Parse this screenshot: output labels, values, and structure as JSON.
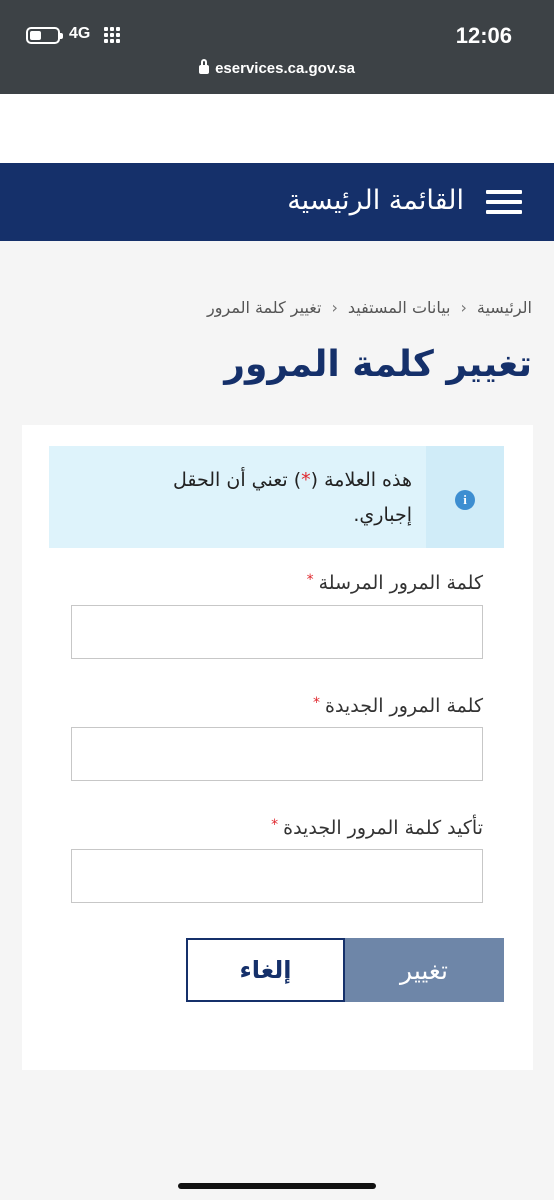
{
  "status_bar": {
    "network": "4G",
    "time": "12:06",
    "url": "eservices.ca.gov.sa"
  },
  "nav": {
    "menu_label": "القائمة الرئيسية",
    "menu_icon": "hamburger-icon"
  },
  "breadcrumb": {
    "items": [
      "الرئيسية",
      "بيانات المستفيد",
      "تغيير كلمة المرور"
    ],
    "separator": "<"
  },
  "page": {
    "title": "تغيير كلمة المرور"
  },
  "alert": {
    "icon": "info-icon",
    "icon_glyph": "i",
    "text_before": "هذه العلامة (",
    "star": "*",
    "text_after": ") تعني أن الحقل إجباري."
  },
  "form": {
    "required_marker": "*",
    "fields": [
      {
        "label": "كلمة المرور المرسلة",
        "value": "",
        "placeholder": ""
      },
      {
        "label": "كلمة المرور الجديدة",
        "value": "",
        "placeholder": ""
      },
      {
        "label": "تأكيد كلمة المرور الجديدة",
        "value": "",
        "placeholder": ""
      }
    ],
    "submit_label": "تغيير",
    "cancel_label": "إلغاء"
  },
  "colors": {
    "primary": "#15306a",
    "submit_button": "#6e86a8",
    "required": "#e0282e",
    "alert_bg": "#def3fb",
    "info_icon": "#3d8ed1"
  }
}
